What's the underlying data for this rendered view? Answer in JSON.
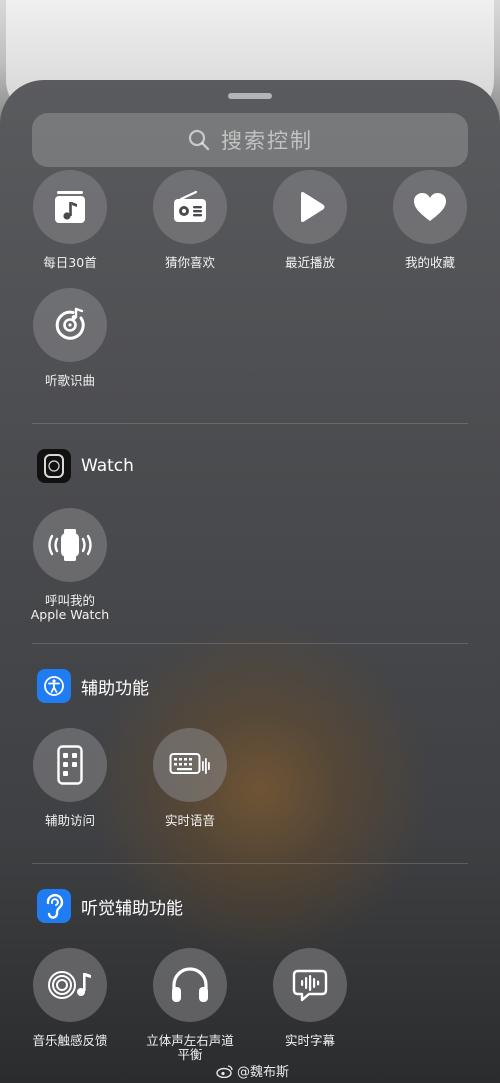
{
  "search": {
    "placeholder": "搜索控制"
  },
  "music": {
    "tiles": [
      {
        "label": "每日30首",
        "icon": "music-note-card-icon"
      },
      {
        "label": "猜你喜欢",
        "icon": "radio-icon"
      },
      {
        "label": "最近播放",
        "icon": "play-icon"
      },
      {
        "label": "我的收藏",
        "icon": "heart-icon"
      },
      {
        "label": "听歌识曲",
        "icon": "song-recognition-icon"
      }
    ]
  },
  "watch": {
    "title": "Watch",
    "tiles": [
      {
        "label": "呼叫我的\nApple Watch",
        "icon": "ping-watch-icon"
      }
    ]
  },
  "accessibility": {
    "title": "辅助功能",
    "tiles": [
      {
        "label": "辅助访问",
        "icon": "assistive-access-icon"
      },
      {
        "label": "实时语音",
        "icon": "live-speech-keyboard-icon"
      }
    ]
  },
  "hearing": {
    "title": "听觉辅助功能",
    "tiles": [
      {
        "label": "音乐触感反馈",
        "icon": "music-haptics-icon"
      },
      {
        "label": "立体声左右声道\n平衡",
        "icon": "headphones-icon"
      },
      {
        "label": "实时字幕",
        "icon": "live-captions-icon"
      }
    ]
  },
  "watermark": {
    "text": "@魏布斯"
  },
  "colors": {
    "accessibility_blue": "#1f7cf2"
  }
}
